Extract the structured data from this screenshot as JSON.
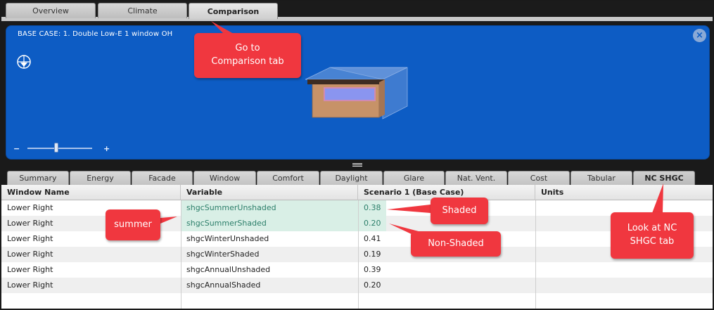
{
  "top_tabs": [
    {
      "label": "Overview"
    },
    {
      "label": "Climate"
    },
    {
      "label": "Comparison"
    }
  ],
  "viewer": {
    "title": "BASE CASE: 1. Double Low-E 1 window OH",
    "close_icon": "×",
    "zoom_minus": "−",
    "zoom_plus": "+",
    "colors": {
      "background": "#0d5cc4"
    }
  },
  "sub_tabs": [
    {
      "label": "Summary"
    },
    {
      "label": "Energy"
    },
    {
      "label": "Facade"
    },
    {
      "label": "Window"
    },
    {
      "label": "Comfort"
    },
    {
      "label": "Daylight"
    },
    {
      "label": "Glare"
    },
    {
      "label": "Nat. Vent."
    },
    {
      "label": "Cost"
    },
    {
      "label": "Tabular"
    },
    {
      "label": "NC SHGC"
    }
  ],
  "table": {
    "headers": [
      "Window Name",
      "Variable",
      "Scenario 1 (Base Case)",
      "Units"
    ],
    "rows": [
      {
        "window": "Lower Right",
        "variable": "shgcSummerUnshaded",
        "value": "0.38",
        "units": ""
      },
      {
        "window": "Lower Right",
        "variable": "shgcSummerShaded",
        "value": "0.20",
        "units": ""
      },
      {
        "window": "Lower Right",
        "variable": "shgcWinterUnshaded",
        "value": "0.41",
        "units": ""
      },
      {
        "window": "Lower Right",
        "variable": "shgcWinterShaded",
        "value": "0.19",
        "units": ""
      },
      {
        "window": "Lower Right",
        "variable": "shgcAnnualUnshaded",
        "value": "0.39",
        "units": ""
      },
      {
        "window": "Lower Right",
        "variable": "shgcAnnualShaded",
        "value": "0.20",
        "units": ""
      }
    ]
  },
  "callouts": {
    "comparison": "Go to\nComparison tab",
    "summer": "summer",
    "shaded": "Shaded",
    "non_shaded": "Non-Shaded",
    "nc_shgc": "Look at NC\nSHGC tab"
  },
  "colors": {
    "callout": "#f0373f",
    "highlight": "#d9efe6",
    "highlight_text": "#2c7f6a"
  }
}
